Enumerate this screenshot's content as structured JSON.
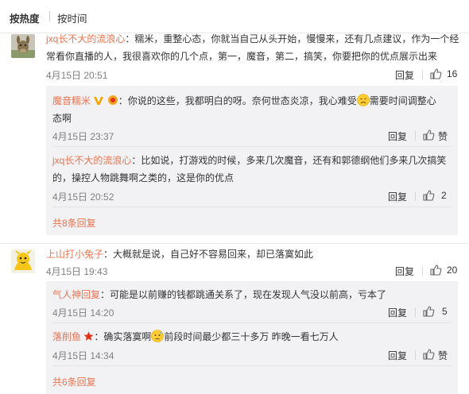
{
  "sort": {
    "hot": "按热度",
    "time": "按时间"
  },
  "comments": [
    {
      "user": "jxq长不大的流浪心",
      "text_line1": "：糯米，重整心态，你就当自己从头开始，慢慢来，还有几点建议，作为一个经",
      "text_line2": "常看你直播的人，我很喜欢你的几个点，第一，魔音，第二，搞笑，你要把你的优点展示出来",
      "time": "4月15日 20:51",
      "reply_label": "回复",
      "likes": "16",
      "replies": [
        {
          "user": "魔音糯米",
          "text_line1a": "：你说的这些，我都明白的呀。奈何世态炎凉，我心难受",
          "text_line1b": "需要时间调整心",
          "text_line2": "态啊",
          "time": "4月15日 23:37",
          "reply_label": "回复",
          "likes": "赞"
        },
        {
          "user": "jxq长不大的流浪心",
          "text_line1": "：比如说，打游戏的时候，多来几次魔音，还有和郭德纲他们多来几次搞笑",
          "text_line2": "的，操控人物跳舞啊之类的，这是你的优点",
          "time": "4月15日 20:52",
          "reply_label": "回复",
          "likes": "2"
        }
      ],
      "more": "共8条回复"
    },
    {
      "user": "上山打小兔子",
      "text": "：大概就是说，自己好不容易回来，却已落寞如此",
      "time": "4月15日 19:43",
      "reply_label": "回复",
      "likes": "20",
      "replies": [
        {
          "user": "气人神回复",
          "text": "：可能是以前赚的钱都跳通关系了，现在发现人气没以前高，亏本了",
          "time": "4月15日 14:20",
          "reply_label": "回复",
          "likes": "5"
        },
        {
          "user": "落削鱼",
          "text_a": "：确实落寞啊",
          "text_b": "前段时间最少都三十多万 昨晚一看七万人",
          "time": "4月15日 14:34",
          "reply_label": "回复",
          "likes": "赞"
        }
      ],
      "more": "共6条回复"
    }
  ],
  "colors": {
    "username": "#eb7350",
    "reply_bg": "#f2f2f5",
    "time": "#808080"
  }
}
